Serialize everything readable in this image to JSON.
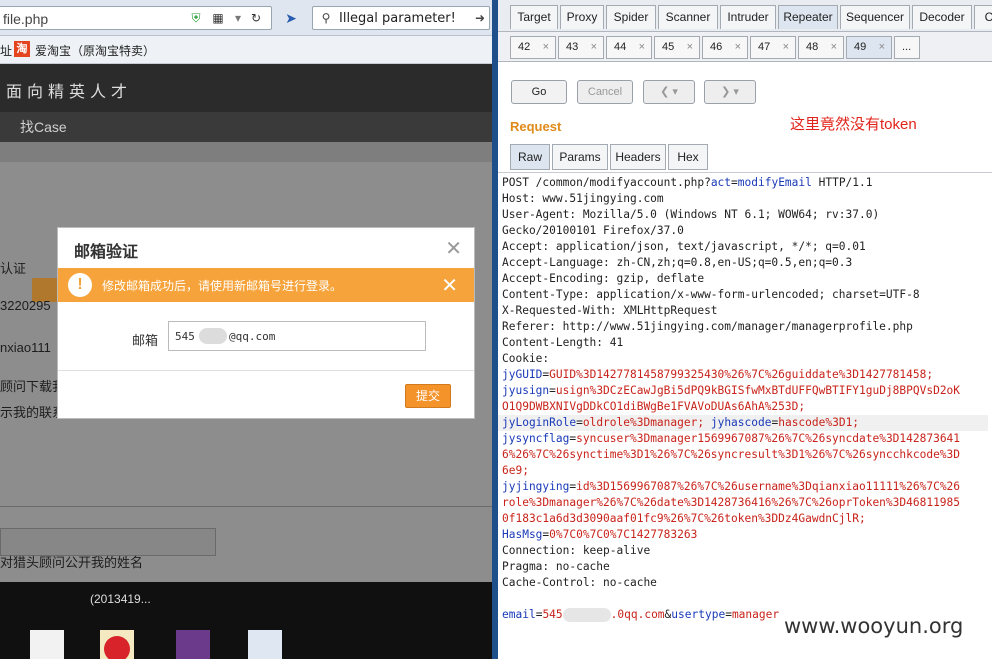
{
  "browser": {
    "url_partial": "file.php",
    "search_query": "Illegal parameter!",
    "bookmarks": [
      "址",
      "爱淘宝（原淘宝特卖）"
    ]
  },
  "website": {
    "logo": "面向精英人才",
    "nav_item": "找Case",
    "under_texts": [
      "认证",
      "3220295",
      "nxiao111",
      "顾问下载我",
      "示我的联系",
      "对猎头顾问公开我的姓名"
    ],
    "modal": {
      "title": "邮箱验证",
      "alert": "修改邮箱成功后，请使用新邮箱号进行登录。",
      "email_label": "邮箱",
      "email_value_prefix": "545",
      "email_value_suffix": "@qq.com",
      "submit": "提交"
    }
  },
  "taskbar": {
    "label": "(2013419..."
  },
  "burp": {
    "main_tabs": [
      "Target",
      "Proxy",
      "Spider",
      "Scanner",
      "Intruder",
      "Repeater",
      "Sequencer",
      "Decoder",
      "C"
    ],
    "active_main_tab": "Repeater",
    "sub_tabs": [
      "42",
      "43",
      "44",
      "45",
      "46",
      "47",
      "48",
      "49",
      "..."
    ],
    "active_sub_tab": "49",
    "buttons": {
      "go": "Go",
      "cancel": "Cancel"
    },
    "request_label": "Request",
    "annotation": "这里竟然没有token",
    "view_tabs": [
      "Raw",
      "Params",
      "Headers",
      "Hex"
    ],
    "active_view_tab": "Raw",
    "request": {
      "line1_method": "POST /common/modifyaccount.php?",
      "line1_param": "act",
      "line1_eq": "=",
      "line1_value": "modifyEmail",
      "line1_proto": " HTTP/1.1",
      "headers": [
        "Host: www.51jingying.com",
        "User-Agent: Mozilla/5.0 (Windows NT 6.1; WOW64; rv:37.0)",
        "Gecko/20100101 Firefox/37.0",
        "Accept: application/json, text/javascript, */*; q=0.01",
        "Accept-Language: zh-CN,zh;q=0.8,en-US;q=0.5,en;q=0.3",
        "Accept-Encoding: gzip, deflate",
        "Content-Type: application/x-www-form-urlencoded; charset=UTF-8",
        "X-Requested-With: XMLHttpRequest",
        "Referer: http://www.51jingying.com/manager/managerprofile.php",
        "Content-Length: 41",
        "Cookie:"
      ],
      "cookie_lines": [
        {
          "k": "jyGUID",
          "v": "GUID%3D1427781458799325430%26%7C%26guiddate%3D1427781458;"
        },
        {
          "k": "jyusign",
          "v": "usign%3DCzECawJgBi5dPQ9kBGISfwMxBTdUFFQwBTIFY1guDj8BPQVsD2oK"
        },
        {
          "k": "",
          "v": "O1Q9DWBXNIVgDDkCO1diBWgBe1FVAVoDUAs6AhA%253D;"
        },
        {
          "k": "jyLoginRole",
          "v": "oldrole%3Dmanager;",
          "k2": "jyhascode",
          "v2": "hascode%3D1;"
        },
        {
          "k": "jysyncflag",
          "v": "syncuser%3Dmanager1569967087%26%7C%26syncdate%3D142873641"
        },
        {
          "k": "",
          "v": "6%26%7C%26synctime%3D1%26%7C%26syncresult%3D1%26%7C%26syncchkcode%3D"
        },
        {
          "k": "",
          "v": "6e9;"
        },
        {
          "k": "jyjingying",
          "v": "id%3D1569967087%26%7C%26username%3Dqianxiao11111%26%7C%26"
        },
        {
          "k": "",
          "v": "role%3Dmanager%26%7C%26date%3D1428736416%26%7C%26oprToken%3D46811985"
        },
        {
          "k": "",
          "v": "0f183c1a6d3d3090aaf01fc9%26%7C%26token%3DDz4GawdnCjlR;"
        },
        {
          "k": "HasMsg",
          "v": "0%7C0%7C0%7C1427783263"
        }
      ],
      "trailer": [
        "Connection: keep-alive",
        "Pragma: no-cache",
        "Cache-Control: no-cache"
      ],
      "body_k1": "email",
      "body_v1a": "545",
      "body_v1b": ".0qq.com",
      "body_amp": "&",
      "body_k2": "usertype",
      "body_v2": "manager"
    }
  },
  "watermark": "www.wooyun.org",
  "colors": {
    "annotation": "#e2231a",
    "request_label": "#e08a1a",
    "cookie_key": "#1a3ab8",
    "cookie_value": "#c8231a",
    "alert_bar": "#f5a33a"
  }
}
